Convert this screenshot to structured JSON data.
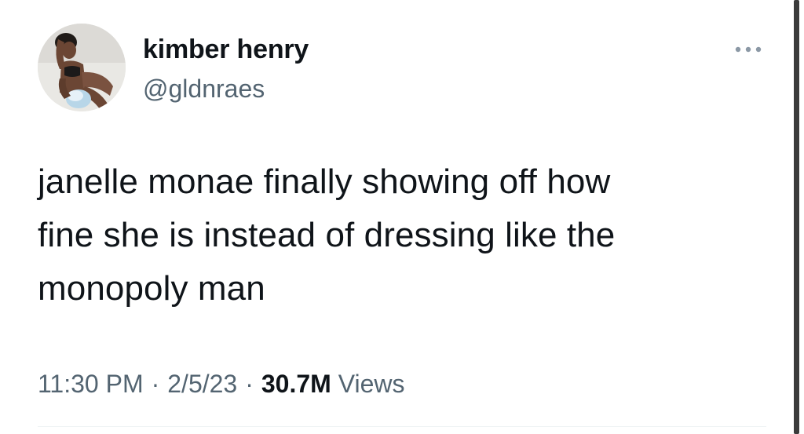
{
  "tweet": {
    "author": {
      "display_name": "kimber henry",
      "handle": "@gldnraes",
      "avatar": "profile-photo"
    },
    "more_icon": "more-horizontal-icon",
    "text": "janelle monae finally showing off how\nfine she is instead of dressing like the\nmonopoly man",
    "time": "11:30 PM",
    "separator": "·",
    "date": "2/5/23",
    "views_count": "30.7M",
    "views_label": "Views"
  },
  "colors": {
    "text_primary": "#0f1419",
    "text_secondary": "#536471",
    "divider": "#eff3f4"
  }
}
